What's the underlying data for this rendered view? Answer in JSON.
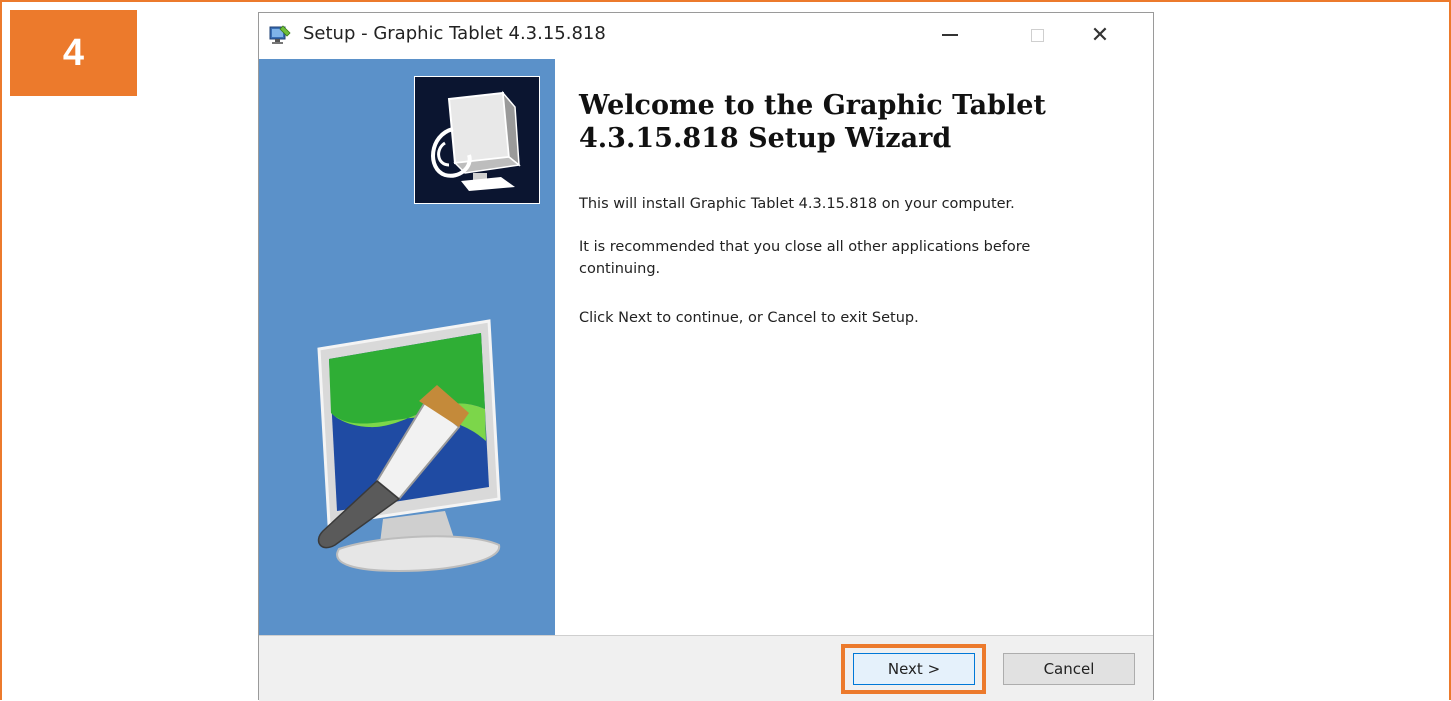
{
  "step": {
    "number": "4",
    "accent_color": "#ec7a2c"
  },
  "window": {
    "title": "Setup - Graphic Tablet 4.3.15.818",
    "icon": "setup-installer-icon",
    "controls": {
      "minimize_icon": "minimize-icon",
      "maximize_icon": "maximize-icon",
      "close_label": "✕"
    }
  },
  "wizard": {
    "heading": "Welcome to the Graphic Tablet 4.3.15.818 Setup Wizard",
    "paragraphs": [
      "This will install Graphic Tablet 4.3.15.818 on your computer.",
      "It is recommended that you close all other applications before continuing.",
      "Click Next to continue, or Cancel to exit Setup."
    ],
    "sidebar_color": "#5b91c9",
    "logo_icon": "tablet-computer-logo-icon",
    "art_icon": "monitor-paintbrush-icon"
  },
  "buttons": {
    "next": "Next >",
    "cancel": "Cancel"
  }
}
